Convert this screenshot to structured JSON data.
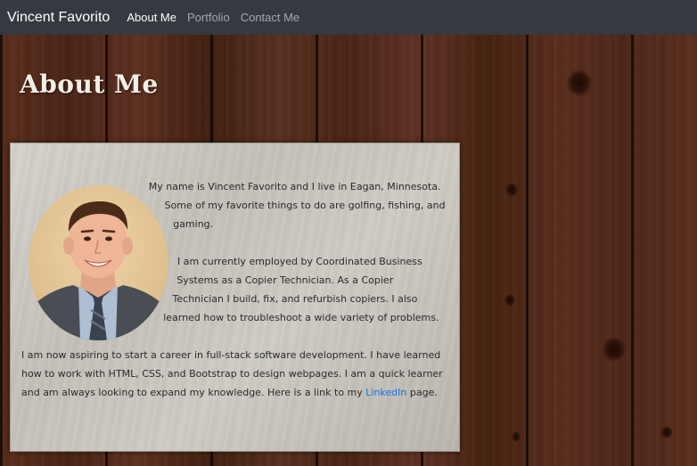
{
  "navbar": {
    "brand": "Vincent Favorito",
    "links": [
      {
        "label": "About Me",
        "active": true
      },
      {
        "label": "Portfolio",
        "active": false
      },
      {
        "label": "Contact Me",
        "active": false
      }
    ]
  },
  "main": {
    "title": "About Me",
    "avatar_icon": "profile-photo",
    "paragraphs": [
      "My name is Vincent Favorito and I live in Eagan, Minnesota. Some of my favorite things to do are golfing, fishing, and gaming.",
      "I am currently employed by Coordinated Business Systems as a Copier Technician. As a Copier Technician I build, fix, and refurbish copiers. I also learned how to troubleshoot a wide variety of problems."
    ],
    "last_paragraph": {
      "before_link": "I am now aspiring to start a career in full-stack software development. I have learned how to work with HTML, CSS, and Bootstrap to design webpages. I am a quick learner and am always looking to expand my knowledge. Here is a link to my ",
      "link_text": "LinkedIn",
      "after_link": " page."
    }
  },
  "colors": {
    "navbar_bg": "#343a40",
    "link": "#1a6fe0",
    "card_bg": "#c8c6bf"
  }
}
